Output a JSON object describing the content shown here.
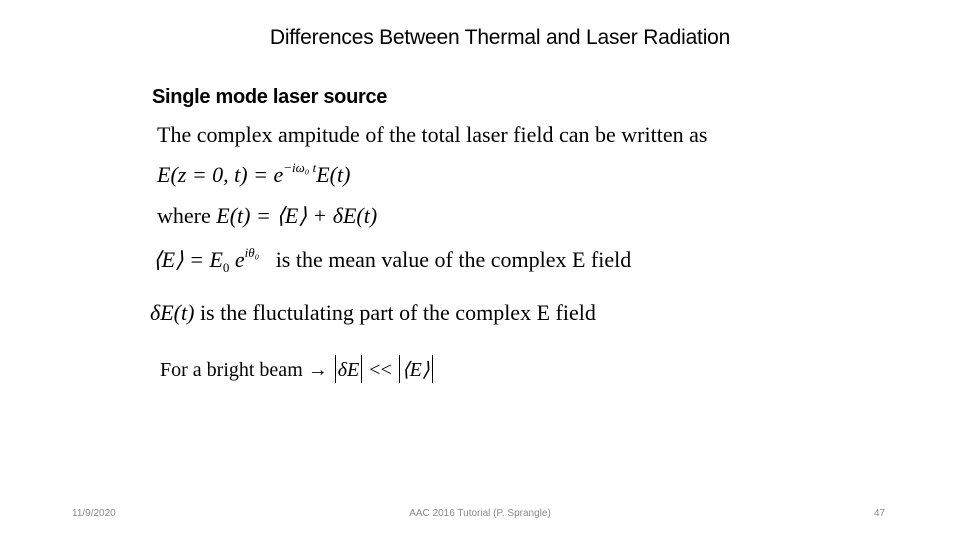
{
  "slide": {
    "title": "Differences Between Thermal and Laser Radiation",
    "subtitle": "Single mode laser source",
    "lines": {
      "intro": "The complex ampitude of the total laser field can be written as",
      "eq1_lhs": "E(z = 0, t) = e",
      "eq1_exp": "−iω₀ t",
      "eq1_rhs": "E(t)",
      "eq2_prefix": "where ",
      "eq2_body": "E(t) = ⟨E⟩ + δE(t)",
      "eq3_lhs": "⟨E⟩ = E",
      "eq3_sub": "0",
      "eq3_e": " e",
      "eq3_exp": "iθ₀",
      "eq3_text": "is the mean value of the complex E field",
      "eq4_math": "δE(t)",
      "eq4_text": " is the fluctulating part of the complex E field",
      "eq5_text": "For a bright beam → ",
      "eq5_a": "δE",
      "eq5_op": " << ",
      "eq5_b": "⟨E⟩"
    }
  },
  "footer": {
    "date": "11/9/2020",
    "center": "AAC 2016 Tutorial (P. Sprangle)",
    "page": "47"
  }
}
